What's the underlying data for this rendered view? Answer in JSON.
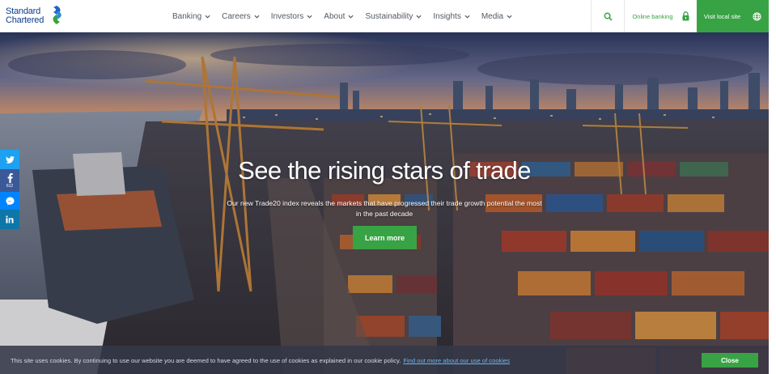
{
  "brand": {
    "line1": "Standard",
    "line2": "Chartered",
    "primary_color": "#0a3c8c",
    "accent_color": "#38a345",
    "mark_blue": "#1a67c9",
    "mark_green": "#38a345"
  },
  "nav": {
    "items": [
      {
        "label": "Banking"
      },
      {
        "label": "Careers"
      },
      {
        "label": "Investors"
      },
      {
        "label": "About"
      },
      {
        "label": "Sustainability"
      },
      {
        "label": "Insights"
      },
      {
        "label": "Media"
      }
    ],
    "chevron_icon": "chevron-down-icon",
    "text_color": "#525a64"
  },
  "utility": {
    "search_icon": "search-icon",
    "online_banking_label": "Online banking",
    "online_banking_icon": "lock-icon",
    "visit_local_label": "Visit local site",
    "visit_local_icon": "globe-icon"
  },
  "hero": {
    "title": "See the rising stars of trade",
    "subtitle": "Our new Trade20 index reveals the markets that have progressed their trade growth potential the most in the past decade",
    "cta_label": "Learn more"
  },
  "share": {
    "twitter_icon": "twitter-icon",
    "facebook_icon": "facebook-icon",
    "facebook_count": "612",
    "messenger_icon": "messenger-icon",
    "linkedin_icon": "linkedin-icon"
  },
  "cookie": {
    "text": "This site uses cookies. By continuing to use our website you are deemed to have agreed to the use of cookies as explained in our cookie policy.",
    "link_text": "Find out more about our use of cookies",
    "close_label": "Close"
  }
}
